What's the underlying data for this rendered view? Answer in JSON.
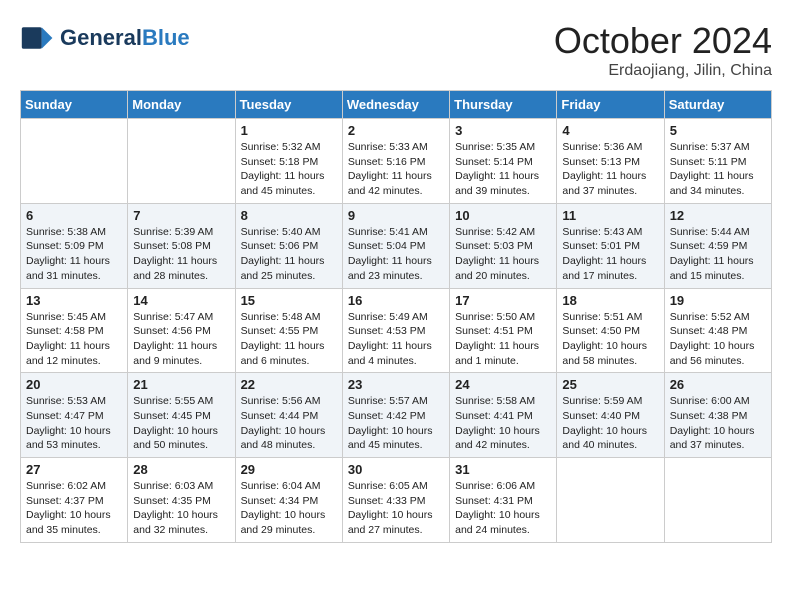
{
  "header": {
    "logo_general": "General",
    "logo_blue": "Blue",
    "month_title": "October 2024",
    "location": "Erdaojiang, Jilin, China"
  },
  "weekdays": [
    "Sunday",
    "Monday",
    "Tuesday",
    "Wednesday",
    "Thursday",
    "Friday",
    "Saturday"
  ],
  "weeks": [
    [
      {
        "day": "",
        "info": ""
      },
      {
        "day": "",
        "info": ""
      },
      {
        "day": "1",
        "info": "Sunrise: 5:32 AM\nSunset: 5:18 PM\nDaylight: 11 hours and 45 minutes."
      },
      {
        "day": "2",
        "info": "Sunrise: 5:33 AM\nSunset: 5:16 PM\nDaylight: 11 hours and 42 minutes."
      },
      {
        "day": "3",
        "info": "Sunrise: 5:35 AM\nSunset: 5:14 PM\nDaylight: 11 hours and 39 minutes."
      },
      {
        "day": "4",
        "info": "Sunrise: 5:36 AM\nSunset: 5:13 PM\nDaylight: 11 hours and 37 minutes."
      },
      {
        "day": "5",
        "info": "Sunrise: 5:37 AM\nSunset: 5:11 PM\nDaylight: 11 hours and 34 minutes."
      }
    ],
    [
      {
        "day": "6",
        "info": "Sunrise: 5:38 AM\nSunset: 5:09 PM\nDaylight: 11 hours and 31 minutes."
      },
      {
        "day": "7",
        "info": "Sunrise: 5:39 AM\nSunset: 5:08 PM\nDaylight: 11 hours and 28 minutes."
      },
      {
        "day": "8",
        "info": "Sunrise: 5:40 AM\nSunset: 5:06 PM\nDaylight: 11 hours and 25 minutes."
      },
      {
        "day": "9",
        "info": "Sunrise: 5:41 AM\nSunset: 5:04 PM\nDaylight: 11 hours and 23 minutes."
      },
      {
        "day": "10",
        "info": "Sunrise: 5:42 AM\nSunset: 5:03 PM\nDaylight: 11 hours and 20 minutes."
      },
      {
        "day": "11",
        "info": "Sunrise: 5:43 AM\nSunset: 5:01 PM\nDaylight: 11 hours and 17 minutes."
      },
      {
        "day": "12",
        "info": "Sunrise: 5:44 AM\nSunset: 4:59 PM\nDaylight: 11 hours and 15 minutes."
      }
    ],
    [
      {
        "day": "13",
        "info": "Sunrise: 5:45 AM\nSunset: 4:58 PM\nDaylight: 11 hours and 12 minutes."
      },
      {
        "day": "14",
        "info": "Sunrise: 5:47 AM\nSunset: 4:56 PM\nDaylight: 11 hours and 9 minutes."
      },
      {
        "day": "15",
        "info": "Sunrise: 5:48 AM\nSunset: 4:55 PM\nDaylight: 11 hours and 6 minutes."
      },
      {
        "day": "16",
        "info": "Sunrise: 5:49 AM\nSunset: 4:53 PM\nDaylight: 11 hours and 4 minutes."
      },
      {
        "day": "17",
        "info": "Sunrise: 5:50 AM\nSunset: 4:51 PM\nDaylight: 11 hours and 1 minute."
      },
      {
        "day": "18",
        "info": "Sunrise: 5:51 AM\nSunset: 4:50 PM\nDaylight: 10 hours and 58 minutes."
      },
      {
        "day": "19",
        "info": "Sunrise: 5:52 AM\nSunset: 4:48 PM\nDaylight: 10 hours and 56 minutes."
      }
    ],
    [
      {
        "day": "20",
        "info": "Sunrise: 5:53 AM\nSunset: 4:47 PM\nDaylight: 10 hours and 53 minutes."
      },
      {
        "day": "21",
        "info": "Sunrise: 5:55 AM\nSunset: 4:45 PM\nDaylight: 10 hours and 50 minutes."
      },
      {
        "day": "22",
        "info": "Sunrise: 5:56 AM\nSunset: 4:44 PM\nDaylight: 10 hours and 48 minutes."
      },
      {
        "day": "23",
        "info": "Sunrise: 5:57 AM\nSunset: 4:42 PM\nDaylight: 10 hours and 45 minutes."
      },
      {
        "day": "24",
        "info": "Sunrise: 5:58 AM\nSunset: 4:41 PM\nDaylight: 10 hours and 42 minutes."
      },
      {
        "day": "25",
        "info": "Sunrise: 5:59 AM\nSunset: 4:40 PM\nDaylight: 10 hours and 40 minutes."
      },
      {
        "day": "26",
        "info": "Sunrise: 6:00 AM\nSunset: 4:38 PM\nDaylight: 10 hours and 37 minutes."
      }
    ],
    [
      {
        "day": "27",
        "info": "Sunrise: 6:02 AM\nSunset: 4:37 PM\nDaylight: 10 hours and 35 minutes."
      },
      {
        "day": "28",
        "info": "Sunrise: 6:03 AM\nSunset: 4:35 PM\nDaylight: 10 hours and 32 minutes."
      },
      {
        "day": "29",
        "info": "Sunrise: 6:04 AM\nSunset: 4:34 PM\nDaylight: 10 hours and 29 minutes."
      },
      {
        "day": "30",
        "info": "Sunrise: 6:05 AM\nSunset: 4:33 PM\nDaylight: 10 hours and 27 minutes."
      },
      {
        "day": "31",
        "info": "Sunrise: 6:06 AM\nSunset: 4:31 PM\nDaylight: 10 hours and 24 minutes."
      },
      {
        "day": "",
        "info": ""
      },
      {
        "day": "",
        "info": ""
      }
    ]
  ]
}
